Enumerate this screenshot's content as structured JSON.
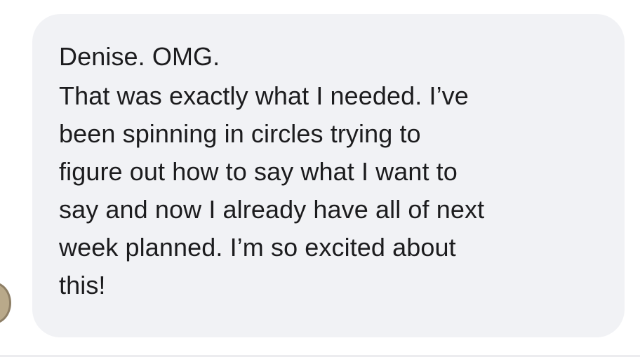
{
  "message": {
    "lines": [
      "Denise. OMG.",
      "That was exactly what I needed. I’ve",
      "been spinning in circles trying to",
      "figure out how to say what I want to",
      "say and now I already have all of next",
      "week planned. I’m so excited about",
      "this!"
    ]
  },
  "colors": {
    "bubble_background": "#f1f2f5",
    "text": "#1c1c1e",
    "page_background": "#ffffff"
  }
}
